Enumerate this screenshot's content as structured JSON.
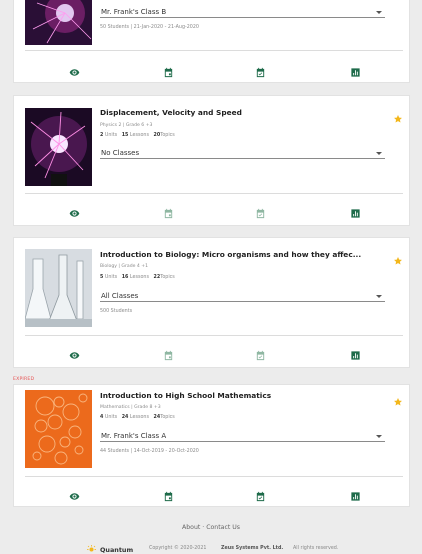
{
  "courses": [
    {
      "title": "",
      "class_select": "Mr. Frank's Class B",
      "info": "50 Students   |   21-Jan-2020 - 21-Aug-2020",
      "starred": false,
      "actions_enabled": true
    },
    {
      "title": "Displacement, Velocity and Speed",
      "meta": "Physics 2 | Grade 6 +3",
      "units": "2",
      "units_label": " Units",
      "lessons": "15",
      "lessons_label": " Lessons",
      "topics": "20",
      "topics_label": "Topics",
      "class_select": "No Classes",
      "starred": true,
      "actions_enabled": false
    },
    {
      "title": "Introduction to Biology: Micro organisms and how they affec...",
      "meta": "Biology | Grade 4 +1",
      "units": "5",
      "units_label": " Units",
      "lessons": "16",
      "lessons_label": " Lessons",
      "topics": "22",
      "topics_label": "Topics",
      "class_select": "All Classes",
      "info": "500 Students",
      "starred": true,
      "actions_enabled": false
    },
    {
      "status": "EXPIRED",
      "title": "Introduction to High School Mathematics",
      "meta": "Mathematics | Grade 8 +3",
      "units": "4",
      "units_label": " Units",
      "lessons": "24",
      "lessons_label": " Lessons",
      "topics": "24",
      "topics_label": "Topics",
      "class_select": "Mr. Frank's Class A",
      "info": "44 Students   |   14-Oct-2019 - 20-Oct-2020",
      "starred": true,
      "actions_enabled": true
    }
  ],
  "actions": [
    "eye-icon",
    "calendar-icon",
    "calendar-check-icon",
    "bar-chart-icon"
  ],
  "footer": {
    "about": "About",
    "separator": " · ",
    "contact": "Contact Us",
    "brand": "Quantum",
    "copyright": "Copyright © 2020-2021",
    "company": "Zeus Systems Pvt. Ltd.",
    "rights": "All rights reserved."
  },
  "colors": {
    "accent_green": "#1e6b4a",
    "disabled_green": "#8fb7a2",
    "star": "#f3b71b",
    "expired": "#e65252",
    "background": "#ececec"
  }
}
